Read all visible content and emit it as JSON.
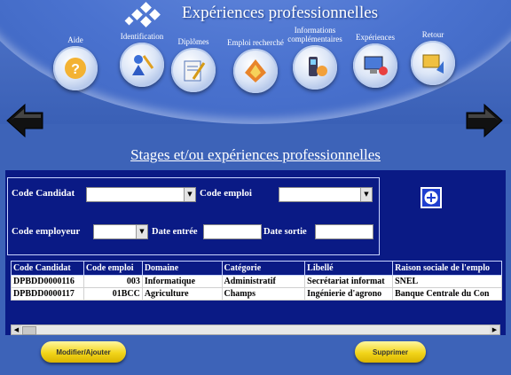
{
  "app": {
    "title": "Expériences professionnelles"
  },
  "nav": [
    {
      "label": "Aide",
      "icon": "help-icon"
    },
    {
      "label": "Identification",
      "icon": "identification-icon"
    },
    {
      "label": "Diplômes",
      "icon": "diploma-icon"
    },
    {
      "label": "Emploi recherché",
      "icon": "job-search-icon"
    },
    {
      "label": "Informations complémentaires",
      "icon": "info-phone-icon"
    },
    {
      "label": "Expériences",
      "icon": "experience-icon"
    },
    {
      "label": "Retour",
      "icon": "return-icon"
    }
  ],
  "section": {
    "title": "Stages et/ou expériences professionnelles"
  },
  "filters": {
    "code_candidat": "Code Candidat",
    "code_emploi": "Code emploi",
    "code_employeur": "Code employeur",
    "date_entree": "Date entrée",
    "date_sortie": "Date sortie"
  },
  "table": {
    "columns": [
      "Code Candidat",
      "Code emploi",
      "Domaine",
      "Catégorie",
      "Libellé",
      "Raison sociale de l'emplo"
    ],
    "rows": [
      [
        "DPBDD0000116",
        "003",
        "Informatique",
        "Administratif",
        "Secrétariat informat",
        "SNEL"
      ],
      [
        "DPBDD0000117",
        "01BCC",
        "Agriculture",
        "Champs",
        "Ingénierie d'agrono",
        "Banque Centrale du Con"
      ]
    ]
  },
  "buttons": {
    "modify": "Modifier/Ajouter",
    "delete": "Supprimer"
  },
  "colors": {
    "panel": "#0a1a85",
    "background": "#3d63b8",
    "pill": "#f2d51a"
  }
}
